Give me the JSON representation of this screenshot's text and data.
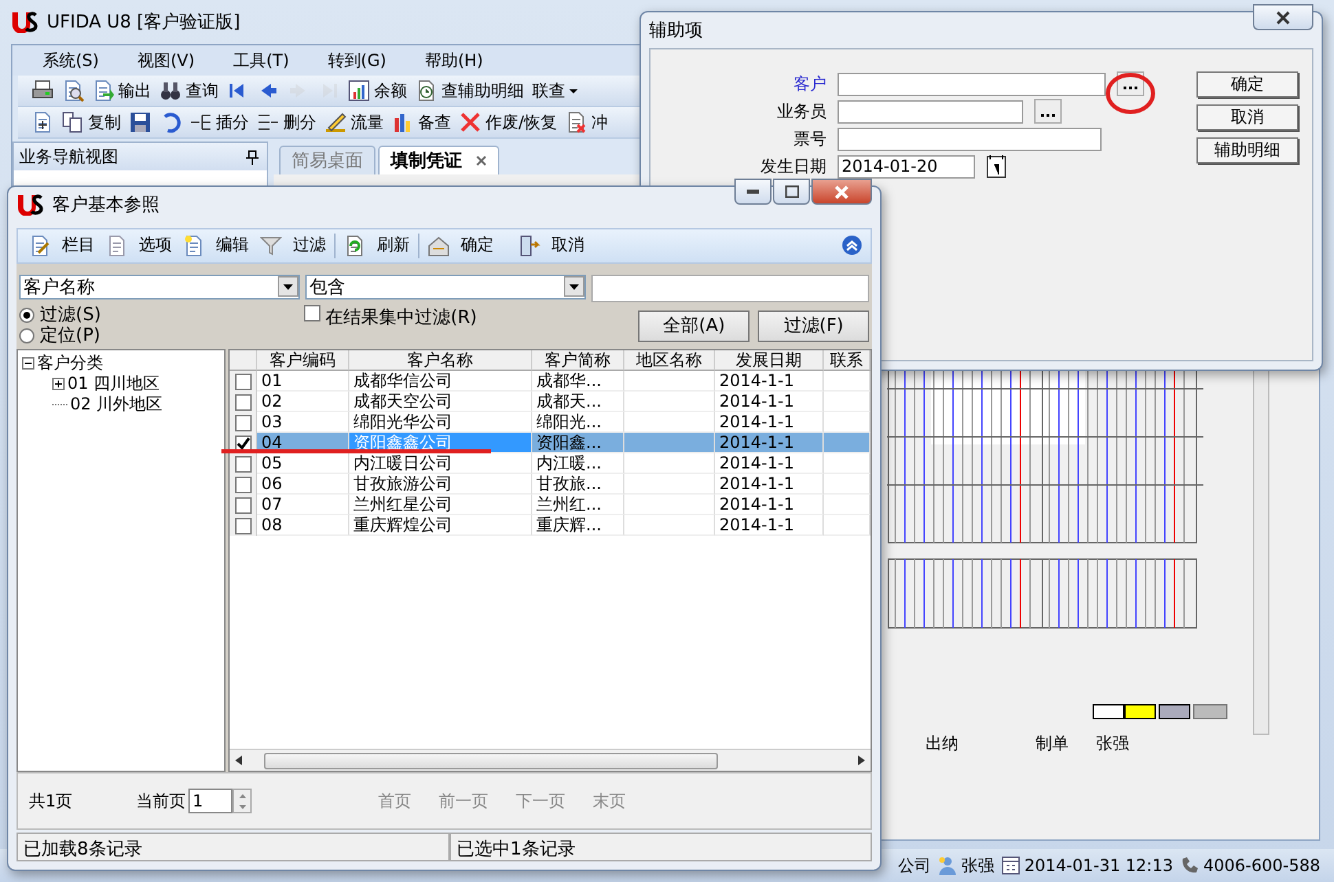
{
  "window": {
    "title": "UFIDA U8 [客户验证版]"
  },
  "menu": [
    "系统(S)",
    "视图(V)",
    "工具(T)",
    "转到(G)",
    "帮助(H)"
  ],
  "toolbar_1": [
    {
      "disabled": false
    },
    {
      "disabled": false
    },
    {
      "label": "输出",
      "disabled": false
    },
    {
      "label": "查询",
      "disabled": false
    },
    {
      "disabled": false
    },
    {
      "disabled": false
    },
    {
      "disabled": true
    },
    {
      "disabled": true
    },
    {
      "label": "余额",
      "disabled": false
    },
    {
      "label": "查辅助明细",
      "disabled": false
    },
    {
      "label": "联查",
      "disabled": false
    }
  ],
  "toolbar_2": [
    {
      "disabled": false
    },
    {
      "label": "复制",
      "disabled": false
    },
    {
      "disabled": false
    },
    {
      "disabled": false
    },
    {
      "label": "插分",
      "disabled": false
    },
    {
      "label": "删分",
      "disabled": false
    },
    {
      "label": "流量",
      "disabled": false
    },
    {
      "label": "备查",
      "disabled": false
    },
    {
      "label": "作废/恢复",
      "disabled": false
    },
    {
      "label": "冲",
      "disabled": false
    }
  ],
  "nav_pane": {
    "title": "业务导航视图"
  },
  "tabs": [
    {
      "label": "简易桌面",
      "selected": false
    },
    {
      "label": "填制凭证",
      "selected": true
    }
  ],
  "voucher": {
    "signatures": [
      "出纳",
      "制单",
      "张强"
    ]
  },
  "status_bar": [
    "公司",
    "张强",
    "2014-01-31 12:13",
    "4006-600-588"
  ],
  "aux_dialog": {
    "title": "辅助项",
    "fields": [
      {
        "label": "客户",
        "highlighted": true,
        "kind": "lookup"
      },
      {
        "label": "业务员",
        "highlighted": false,
        "kind": "lookup"
      },
      {
        "label": "票号",
        "highlighted": false,
        "kind": "text"
      },
      {
        "label": "发生日期",
        "highlighted": false,
        "kind": "date",
        "value": "2014-01-20"
      }
    ],
    "buttons": [
      "确定",
      "取消",
      "辅助明细"
    ]
  },
  "customer_dialog": {
    "title": "客户基本参照",
    "toolbar": [
      "栏目",
      "选项",
      "编辑",
      "过滤",
      "刷新",
      "确定",
      "取消"
    ],
    "filter": {
      "field": "客户名称",
      "operator": "包含",
      "modes": [
        {
          "label": "过滤(S)",
          "selected": true
        },
        {
          "label": "定位(P)",
          "selected": false
        }
      ],
      "in_results": {
        "label": "在结果集中过滤(R)",
        "checked": false
      },
      "buttons": [
        "全部(A)",
        "过滤(F)"
      ]
    },
    "tree": {
      "label": "客户分类",
      "expanded": true,
      "children": [
        {
          "label": "01 四川地区",
          "expanded": false
        },
        {
          "label": "02 川外地区"
        }
      ]
    },
    "table": {
      "columns": [
        "客户编码",
        "客户名称",
        "客户简称",
        "地区名称",
        "发展日期",
        "联系"
      ],
      "rows": [
        {
          "code": "01",
          "name": "成都华信公司",
          "short_name": "成都华...",
          "date": "2014-1-1",
          "checked": false,
          "selected": false
        },
        {
          "code": "02",
          "name": "成都天空公司",
          "short_name": "成都天...",
          "date": "2014-1-1",
          "checked": false,
          "selected": false
        },
        {
          "code": "03",
          "name": "绵阳光华公司",
          "short_name": "绵阳光...",
          "date": "2014-1-1",
          "checked": false,
          "selected": false
        },
        {
          "code": "04",
          "name": "资阳鑫鑫公司",
          "short_name": "资阳鑫...",
          "date": "2014-1-1",
          "checked": true,
          "selected": true
        },
        {
          "code": "05",
          "name": "内江暖日公司",
          "short_name": "内江暖...",
          "date": "2014-1-1",
          "checked": false,
          "selected": false
        },
        {
          "code": "06",
          "name": "甘孜旅游公司",
          "short_name": "甘孜旅...",
          "date": "2014-1-1",
          "checked": false,
          "selected": false
        },
        {
          "code": "07",
          "name": "兰州红星公司",
          "short_name": "兰州红...",
          "date": "2014-1-1",
          "checked": false,
          "selected": false
        },
        {
          "code": "08",
          "name": "重庆辉煌公司",
          "short_name": "重庆辉...",
          "date": "2014-1-1",
          "checked": false,
          "selected": false
        }
      ]
    },
    "pagination": {
      "total": "共1页",
      "current_label": "当前页",
      "current": "1",
      "links": [
        {
          "label": "首页",
          "disabled": true
        },
        {
          "label": "前一页",
          "disabled": true
        },
        {
          "label": "下一页",
          "disabled": true
        },
        {
          "label": "末页",
          "disabled": true
        }
      ]
    },
    "status_bar": [
      "已加载8条记录",
      "已选中1条记录"
    ]
  }
}
